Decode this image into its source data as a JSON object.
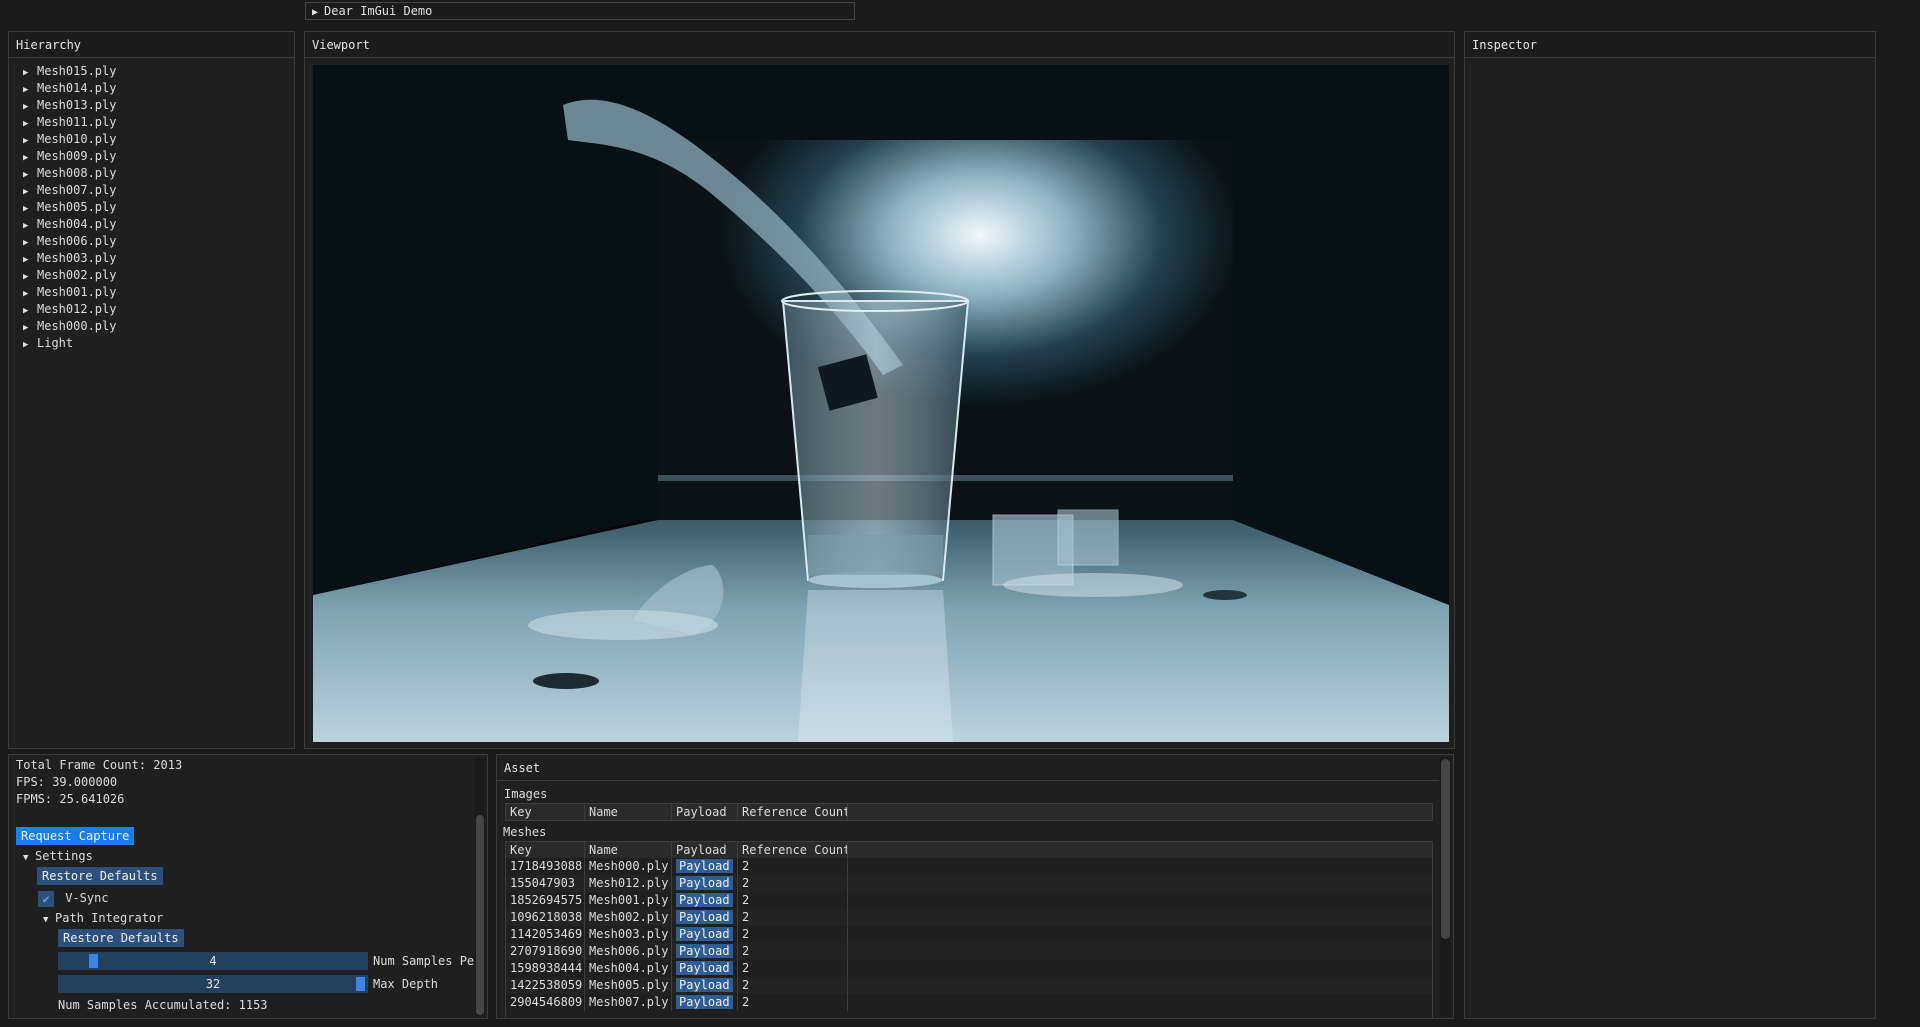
{
  "demo_window": {
    "label": "Dear ImGui Demo"
  },
  "hierarchy": {
    "title": "Hierarchy",
    "items": [
      "Mesh015.ply",
      "Mesh014.ply",
      "Mesh013.ply",
      "Mesh011.ply",
      "Mesh010.ply",
      "Mesh009.ply",
      "Mesh008.ply",
      "Mesh007.ply",
      "Mesh005.ply",
      "Mesh004.ply",
      "Mesh006.ply",
      "Mesh003.ply",
      "Mesh002.ply",
      "Mesh001.ply",
      "Mesh012.ply",
      "Mesh000.ply",
      "Light"
    ]
  },
  "viewport": {
    "title": "Viewport"
  },
  "inspector": {
    "title": "Inspector"
  },
  "stats": {
    "total_frame_count": "Total Frame Count: 2013",
    "fps": "FPS: 39.000000",
    "fpms": "FPMS: 25.641026",
    "request_capture": "Request Capture",
    "settings_label": "Settings",
    "restore_defaults": "Restore Defaults",
    "vsync_label": "V-Sync",
    "vsync_checked": true,
    "path_integrator_label": "Path Integrator",
    "path_restore_defaults": "Restore Defaults",
    "num_samples_value": "4",
    "num_samples_label": "Num Samples Pe",
    "max_depth_value": "32",
    "max_depth_label": "Max Depth",
    "num_samples_accumulated": "Num Samples Accumulated: 1153"
  },
  "asset": {
    "title": "Asset",
    "images_label": "Images",
    "meshes_label": "Meshes",
    "columns": [
      "Key",
      "Name",
      "Payload",
      "Reference Count"
    ],
    "mesh_rows": [
      {
        "key": "1718493088",
        "name": "Mesh000.ply",
        "payload": "Payload",
        "refs": "2"
      },
      {
        "key": "155047903",
        "name": "Mesh012.ply",
        "payload": "Payload",
        "refs": "2"
      },
      {
        "key": "1852694575",
        "name": "Mesh001.ply",
        "payload": "Payload",
        "refs": "2"
      },
      {
        "key": "1096218038",
        "name": "Mesh002.ply",
        "payload": "Payload",
        "refs": "2"
      },
      {
        "key": "1142053469",
        "name": "Mesh003.ply",
        "payload": "Payload",
        "refs": "2"
      },
      {
        "key": "2707918690",
        "name": "Mesh006.ply",
        "payload": "Payload",
        "refs": "2"
      },
      {
        "key": "1598938444",
        "name": "Mesh004.ply",
        "payload": "Payload",
        "refs": "2"
      },
      {
        "key": "1422538059",
        "name": "Mesh005.ply",
        "payload": "Payload",
        "refs": "2"
      },
      {
        "key": "2904546809",
        "name": "Mesh007.ply",
        "payload": "Payload",
        "refs": "2"
      }
    ]
  }
}
